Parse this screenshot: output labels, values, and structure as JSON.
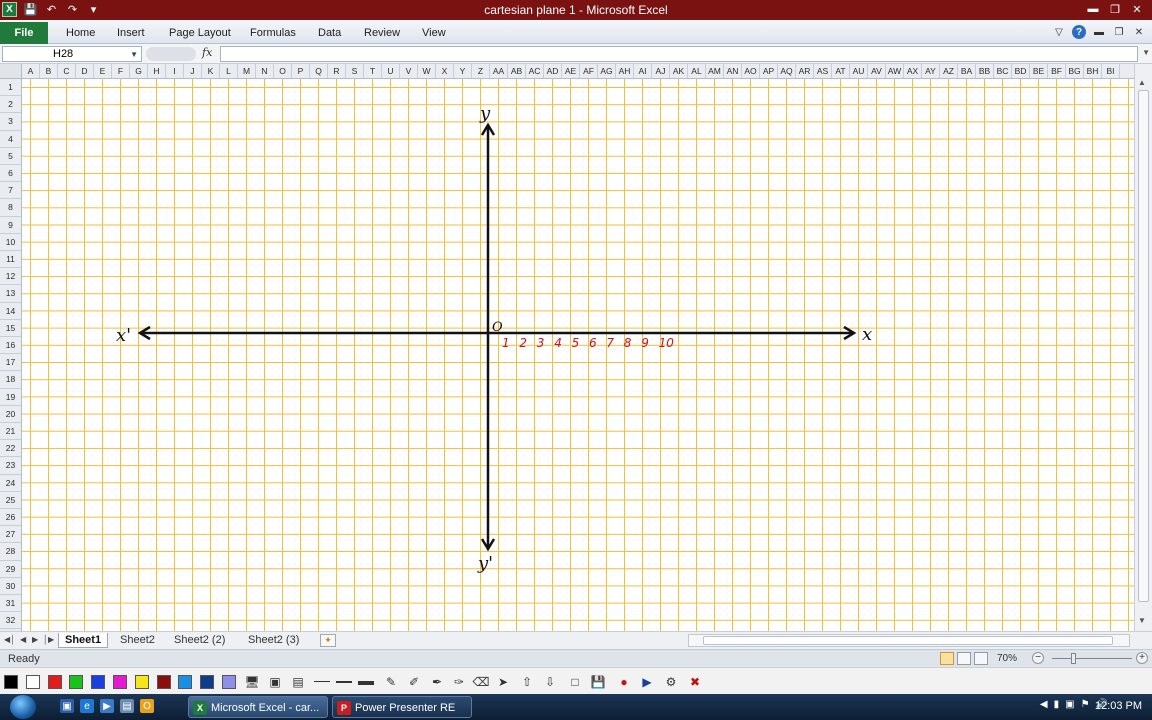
{
  "window": {
    "title": "cartesian plane 1 - Microsoft Excel",
    "app_icon_label": "X"
  },
  "ribbon": {
    "file_label": "File",
    "tabs": [
      "Home",
      "Insert",
      "Page Layout",
      "Formulas",
      "Data",
      "Review",
      "View"
    ]
  },
  "formula_bar": {
    "name_box": "H28",
    "fx_label": "fx",
    "formula_value": ""
  },
  "sheet": {
    "columns": [
      "A",
      "B",
      "C",
      "D",
      "E",
      "F",
      "G",
      "H",
      "I",
      "J",
      "K",
      "L",
      "M",
      "N",
      "O",
      "P",
      "Q",
      "R",
      "S",
      "T",
      "U",
      "V",
      "W",
      "X",
      "Y",
      "Z",
      "AA",
      "AB",
      "AC",
      "AD",
      "AE",
      "AF",
      "AG",
      "AH",
      "AI",
      "AJ",
      "AK",
      "AL",
      "AM",
      "AN",
      "AO",
      "AP",
      "AQ",
      "AR",
      "AS",
      "AT",
      "AU",
      "AV",
      "AW",
      "AX",
      "AY",
      "AZ",
      "BA",
      "BB",
      "BC",
      "BD",
      "BE",
      "BF",
      "BG",
      "BH",
      "BI"
    ],
    "rows": [
      "1",
      "2",
      "3",
      "4",
      "5",
      "6",
      "7",
      "8",
      "9",
      "10",
      "11",
      "12",
      "13",
      "14",
      "15",
      "16",
      "17",
      "18",
      "19",
      "20",
      "21",
      "22",
      "23",
      "24",
      "25",
      "26",
      "27",
      "28",
      "29",
      "30",
      "31",
      "32"
    ],
    "grid_color": "#f1be3d"
  },
  "drawing": {
    "labels": {
      "y_pos": "y",
      "y_neg": "y'",
      "x_pos": "x",
      "x_neg": "x'",
      "origin": "O"
    },
    "ticks": [
      "1",
      "2",
      "3",
      "4",
      "5",
      "6",
      "7",
      "8",
      "9",
      "10"
    ],
    "tick_color": "#d0121e",
    "axis_color": "#111111"
  },
  "sheet_tabs": [
    "Sheet1",
    "Sheet2",
    "Sheet2 (2)",
    "Sheet2 (3)"
  ],
  "active_sheet": "Sheet1",
  "status": {
    "ready": "Ready",
    "zoom": "70%"
  },
  "presenter_toolbar": {
    "colors": [
      "#000000",
      "#ffffff",
      "#e31b1b",
      "#19c319",
      "#1a3fe0",
      "#e619d2",
      "#f5e51a",
      "#8b0e0e",
      "#1a8fe6",
      "#0f3c8a",
      "#8f8fe6"
    ]
  },
  "taskbar": {
    "items": [
      "Microsoft Excel - car...",
      "Power Presenter RE"
    ],
    "clock": "12:03 PM"
  }
}
